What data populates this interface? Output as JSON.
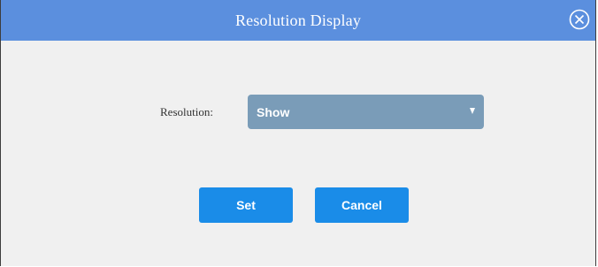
{
  "dialog": {
    "title": "Resolution Display",
    "close_icon": "close-circle-x-icon"
  },
  "form": {
    "resolution_label": "Resolution:",
    "resolution_value": "Show",
    "dropdown_icon": "caret-down-icon"
  },
  "actions": {
    "set_label": "Set",
    "cancel_label": "Cancel"
  },
  "colors": {
    "titlebar": "#5b8fde",
    "select_bg": "#7a9cb8",
    "button_bg": "#1a8ce8",
    "body_bg": "#f0f0f0"
  }
}
